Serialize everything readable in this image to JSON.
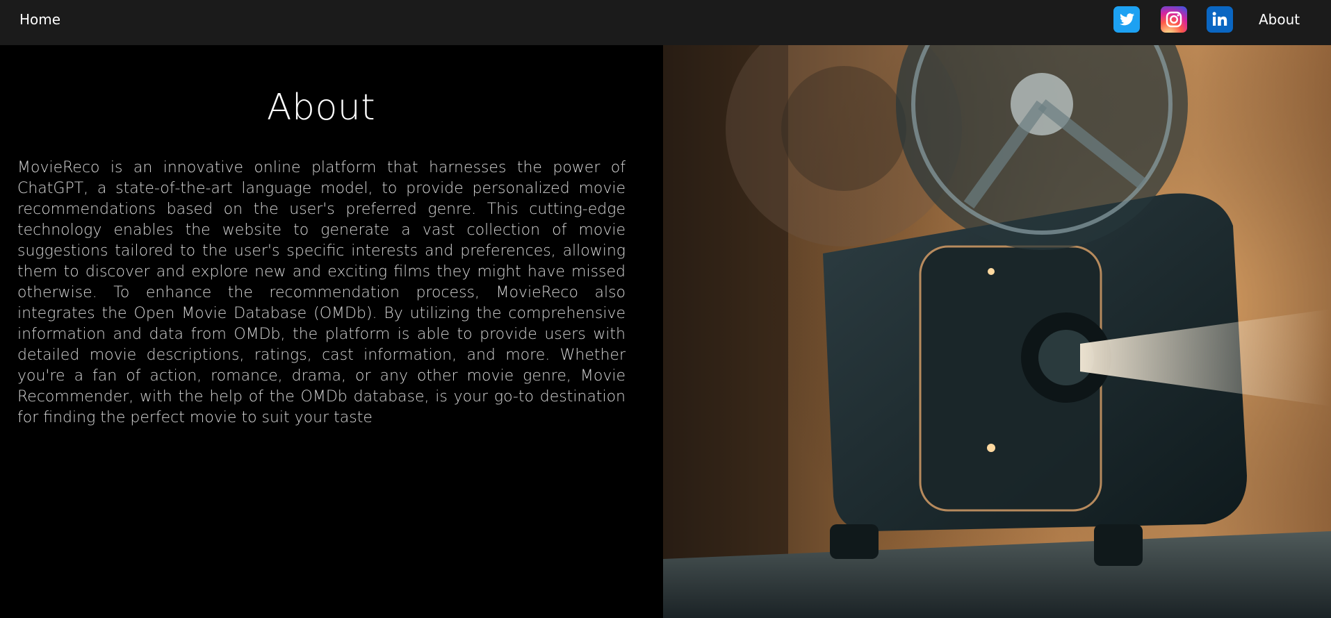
{
  "nav": {
    "home_label": "Home",
    "about_label": "About",
    "social": [
      {
        "name": "twitter",
        "icon": "twitter-bird-icon",
        "color": "#1da1f2"
      },
      {
        "name": "instagram",
        "icon": "instagram-camera-icon",
        "color": "#d6249f"
      },
      {
        "name": "linkedin",
        "icon": "linkedin-in-icon",
        "color": "#0a66c2"
      }
    ]
  },
  "about": {
    "title": "About",
    "body": "MovieReco is an innovative online platform that harnesses the power of ChatGPT, a state-of-the-art language model, to provide personalized movie recommendations based on the user's preferred genre. This cutting-edge technology enables the website to generate a vast collection of movie suggestions tailored to the user's specific interests and preferences, allowing them to discover and explore new and exciting films they might have missed otherwise. To enhance the recommendation process, MovieReco also integrates the Open Movie Database (OMDb). By utilizing the comprehensive information and data from OMDb, the platform is able to provide users with detailed movie descriptions, ratings, cast information, and more. Whether you're a fan of action, romance, drama, or any other movie genre, Movie Recommender, with the help of the OMDb database, is your go-to destination for finding the perfect movie to suit your taste"
  },
  "hero_image": {
    "subject": "vintage-film-projector-photo",
    "colors": {
      "warm": "#c88d54",
      "dark": "#1a2a2e",
      "beam": "#f0e2c8"
    }
  }
}
